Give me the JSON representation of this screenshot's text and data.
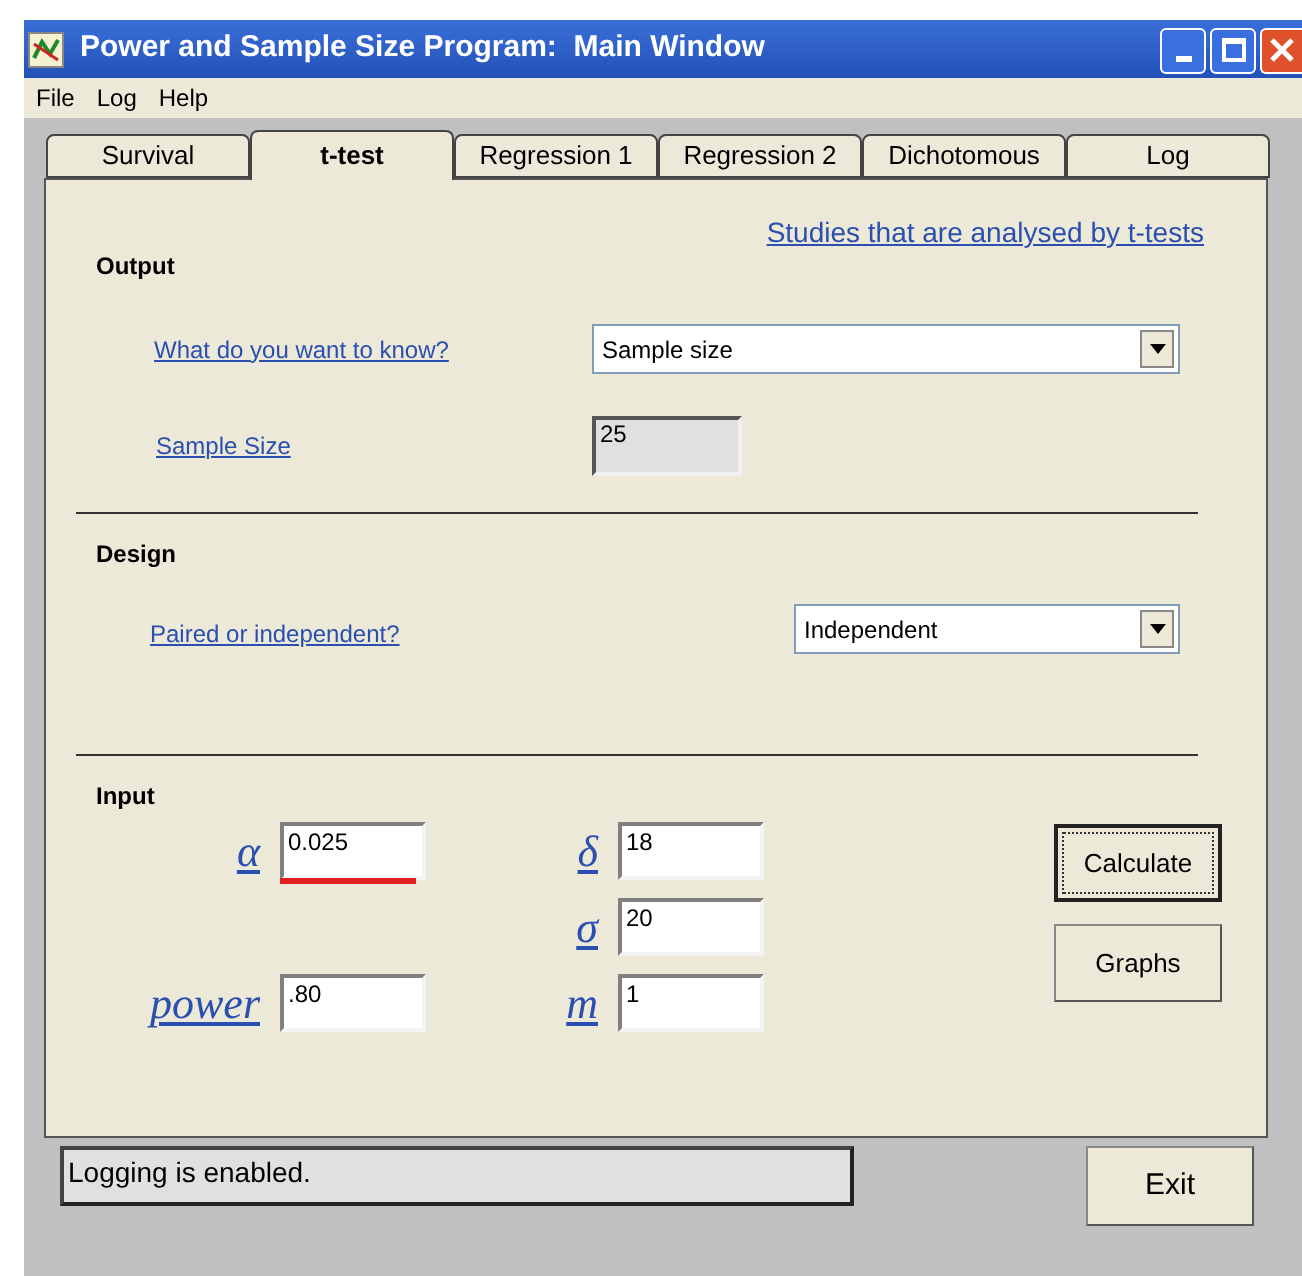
{
  "window": {
    "title": "Power and Sample Size Program:  Main Window"
  },
  "menu": [
    "File",
    "Log",
    "Help"
  ],
  "tabs": [
    {
      "label": "Survival",
      "selected": false
    },
    {
      "label": "t-test",
      "selected": true
    },
    {
      "label": "Regression 1",
      "selected": false
    },
    {
      "label": "Regression 2",
      "selected": false
    },
    {
      "label": "Dichotomous",
      "selected": false
    },
    {
      "label": "Log",
      "selected": false
    }
  ],
  "header_link": "Studies that are analysed by t-tests",
  "output": {
    "title": "Output",
    "question": {
      "label": "What do you want to know?",
      "value": "Sample size"
    },
    "result": {
      "label": "Sample Size",
      "value": "25"
    }
  },
  "design": {
    "title": "Design",
    "paired": {
      "label": "Paired or independent?",
      "value": "Independent"
    }
  },
  "input": {
    "title": "Input",
    "fields": [
      {
        "label": "α",
        "value": "0.025",
        "flagged": true
      },
      {
        "label": "power",
        "value": ".80",
        "flagged": false
      },
      {
        "label": "δ",
        "value": "18",
        "flagged": false
      },
      {
        "label": "σ",
        "value": "20",
        "flagged": false
      },
      {
        "label": "m",
        "value": "1",
        "flagged": false
      }
    ]
  },
  "buttons": [
    {
      "label": "Calculate",
      "focused": true
    },
    {
      "label": "Graphs",
      "focused": false
    }
  ],
  "status": "Logging is enabled.",
  "exit_button": "Exit"
}
